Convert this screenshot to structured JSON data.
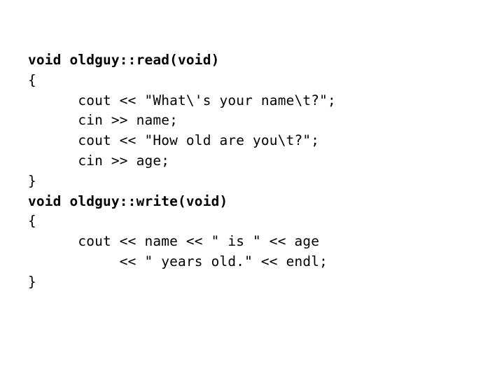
{
  "slide": {
    "background_color": "#ffffff",
    "text_color": "#000000",
    "language": "C++",
    "code_lines": [
      {
        "text": "void oldguy::read(void)",
        "bold": true
      },
      {
        "text": "{",
        "bold": false
      },
      {
        "text": "      cout << \"What\\'s your name\\t?\";",
        "bold": false
      },
      {
        "text": "      cin >> name;",
        "bold": false
      },
      {
        "text": "      cout << \"How old are you\\t?\";",
        "bold": false
      },
      {
        "text": "      cin >> age;",
        "bold": false
      },
      {
        "text": "}",
        "bold": false
      },
      {
        "text": "void oldguy::write(void)",
        "bold": true
      },
      {
        "text": "{",
        "bold": false
      },
      {
        "text": "      cout << name << \" is \" << age",
        "bold": false
      },
      {
        "text": "           << \" years old.\" << endl;",
        "bold": false
      },
      {
        "text": "}",
        "bold": false
      }
    ]
  }
}
